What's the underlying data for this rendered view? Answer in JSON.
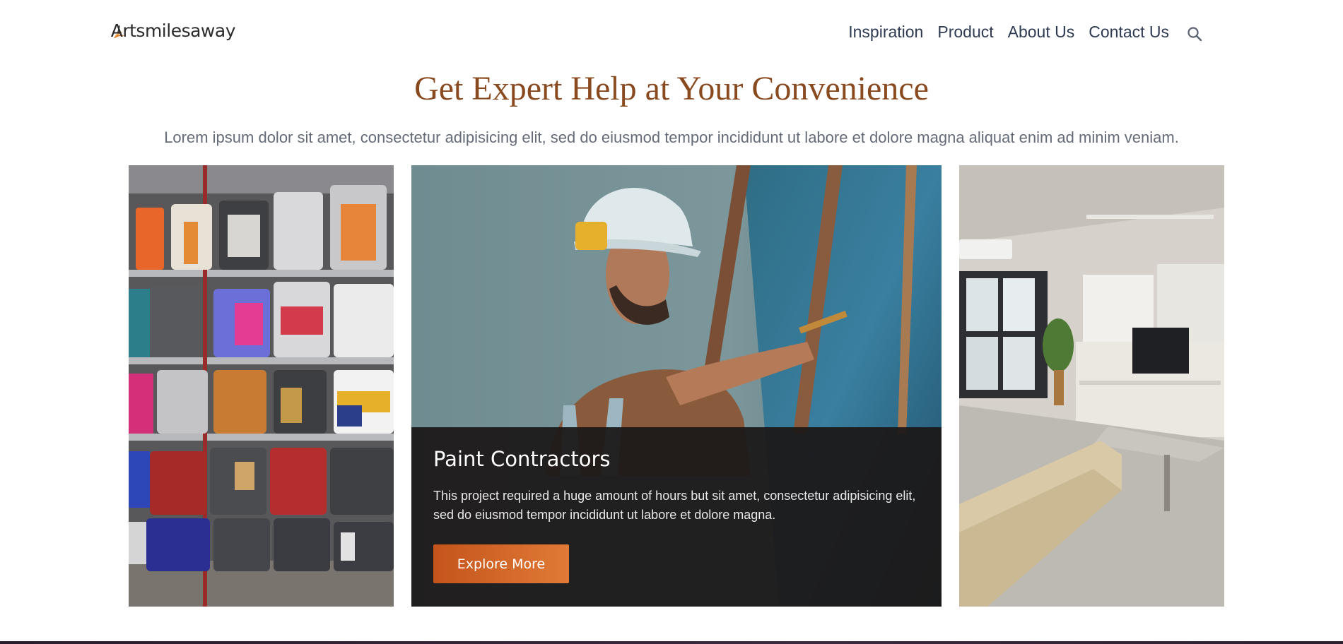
{
  "header": {
    "logo_text": "Artsmilesaway",
    "logo_icon": "brush-swoosh-icon",
    "nav": [
      {
        "label": "Inspiration"
      },
      {
        "label": "Product"
      },
      {
        "label": "About Us"
      },
      {
        "label": "Contact Us"
      }
    ],
    "search_icon": "search-icon"
  },
  "hero": {
    "title": "Get Expert Help at Your Convenience",
    "subtitle": "Lorem ipsum dolor sit amet, consectetur adipisicing elit, sed do eiusmod tempor incididunt ut labore et dolore magna aliquat enim ad minim veniam."
  },
  "cards": [
    {
      "image": "paint-cans-shelf-image"
    },
    {
      "image": "painter-at-canvas-image",
      "title": "Paint Contractors",
      "text": "This project required a huge amount of hours but sit amet, consectetur adipisicing elit, sed do eiusmod tempor incididunt ut labore et dolore magna.",
      "button_label": "Explore More"
    },
    {
      "image": "renovated-room-image"
    }
  ],
  "colors": {
    "title": "#8a4a1f",
    "nav": "#2f3b52",
    "subtitle": "#646b77",
    "button_start": "#c4541b",
    "button_end": "#e07a36",
    "overlay": "#1c1818"
  }
}
